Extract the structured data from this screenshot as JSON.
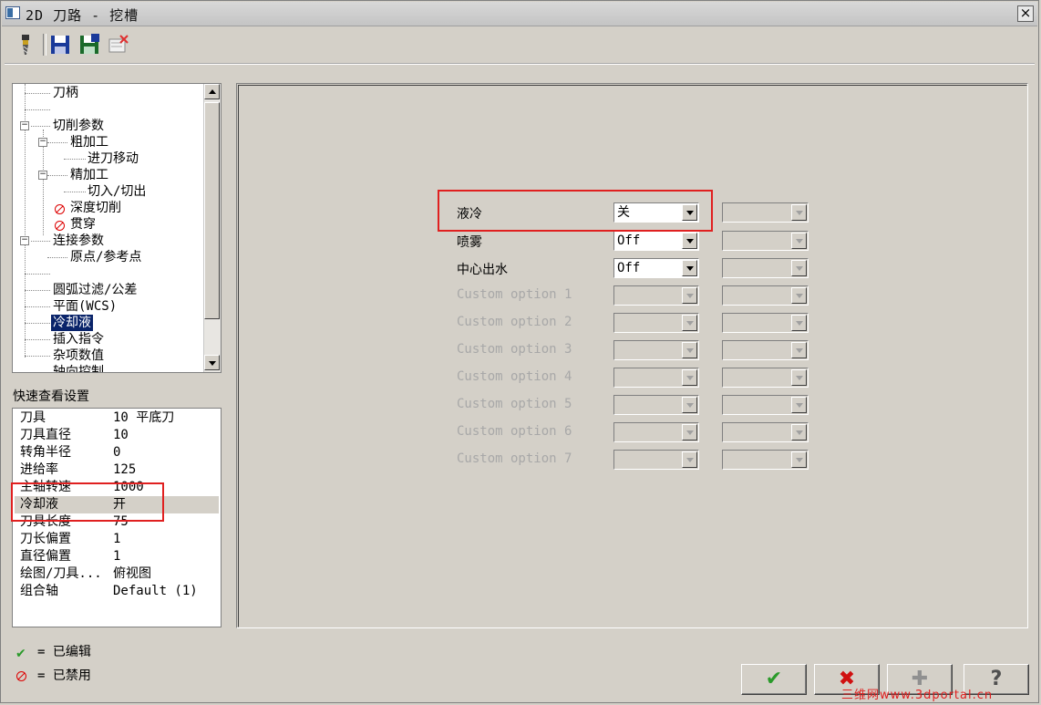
{
  "window": {
    "title": "2D 刀路 - 挖槽",
    "close_glyph": "×"
  },
  "toolbar": {
    "icons": [
      "tool-icon",
      "save-icon",
      "save-as-icon",
      "delete-icon"
    ]
  },
  "tree": {
    "items": [
      {
        "label": "刀柄"
      },
      {
        "label": "切削参数"
      },
      {
        "label": "粗加工"
      },
      {
        "label": "进刀移动"
      },
      {
        "label": "精加工"
      },
      {
        "label": "切入/切出"
      },
      {
        "label": "深度切削"
      },
      {
        "label": "贯穿"
      },
      {
        "label": "连接参数"
      },
      {
        "label": "原点/参考点"
      },
      {
        "label": "圆弧过滤/公差"
      },
      {
        "label": "平面(WCS)"
      },
      {
        "label": "冷却液"
      },
      {
        "label": "插入指令"
      },
      {
        "label": "杂项数值"
      },
      {
        "label": "轴向控制"
      }
    ],
    "selected": "冷却液"
  },
  "quick_view": {
    "label": "快速查看设置",
    "rows": [
      {
        "key": "刀具",
        "value": "10 平底刀"
      },
      {
        "key": "刀具直径",
        "value": "10"
      },
      {
        "key": "转角半径",
        "value": "0"
      },
      {
        "key": "进给率",
        "value": "125"
      },
      {
        "key": "主轴转速",
        "value": "1000"
      },
      {
        "key": "冷却液",
        "value": "开"
      },
      {
        "key": "刀具长度",
        "value": "75"
      },
      {
        "key": "刀长偏置",
        "value": "1"
      },
      {
        "key": "直径偏置",
        "value": "1"
      },
      {
        "key": "绘图/刀具...",
        "value": "俯视图"
      },
      {
        "key": "组合轴",
        "value": "Default (1)"
      }
    ]
  },
  "legend": {
    "edited_label": "= 已编辑",
    "disabled_label": "= 已禁用"
  },
  "coolant": {
    "options": [
      {
        "label": "液冷",
        "value": "关",
        "enabled": true
      },
      {
        "label": "喷雾",
        "value": "Off",
        "enabled": true
      },
      {
        "label": "中心出水",
        "value": "Off",
        "enabled": true
      },
      {
        "label": "Custom option 1",
        "value": "",
        "enabled": false
      },
      {
        "label": "Custom option 2",
        "value": "",
        "enabled": false
      },
      {
        "label": "Custom option 3",
        "value": "",
        "enabled": false
      },
      {
        "label": "Custom option 4",
        "value": "",
        "enabled": false
      },
      {
        "label": "Custom option 5",
        "value": "",
        "enabled": false
      },
      {
        "label": "Custom option 6",
        "value": "",
        "enabled": false
      },
      {
        "label": "Custom option 7",
        "value": "",
        "enabled": false
      }
    ]
  },
  "buttons": {
    "ok": "✔",
    "cancel": "✖",
    "add": "✚",
    "help": "?"
  },
  "watermark": "三维网www.3dportal.cn",
  "colors": {
    "highlight_box": "#e02020",
    "selection": "#0a246a",
    "ok_green": "#2a9a2a",
    "cancel_red": "#d01010"
  }
}
